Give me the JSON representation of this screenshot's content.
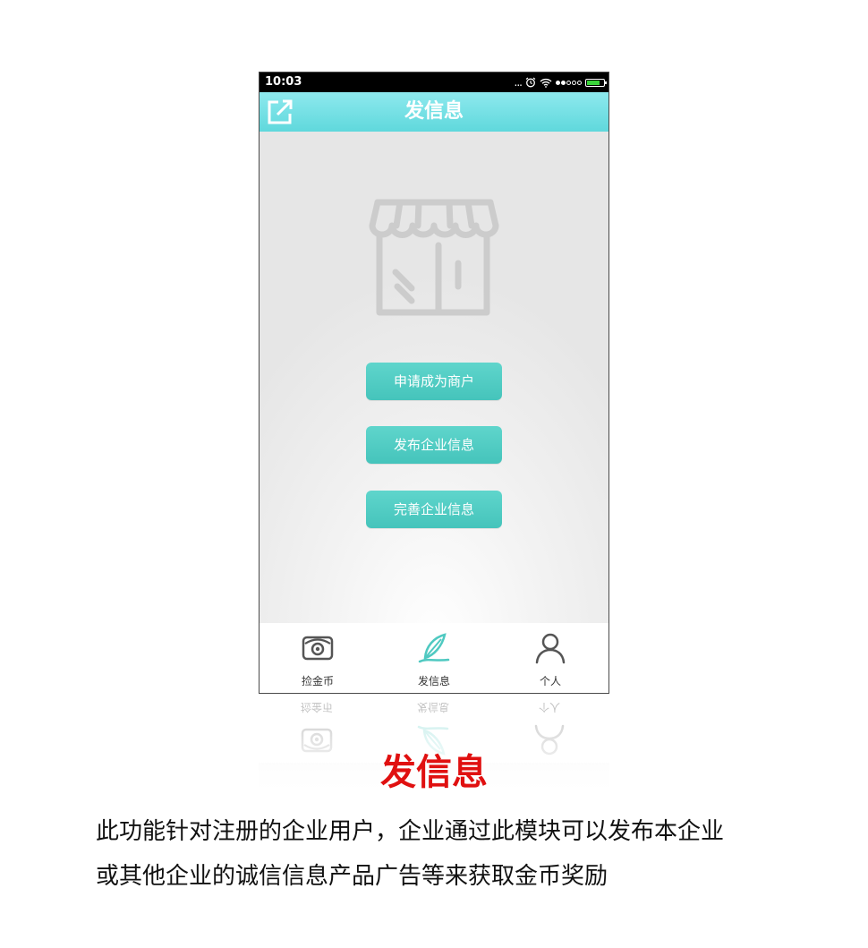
{
  "status_bar": {
    "time": "10:03",
    "dots": "...",
    "alarm_icon": "alarm-clock-icon",
    "wifi_icon": "wifi-icon",
    "battery_level": 0.75,
    "battery_color": "#3bd53b"
  },
  "nav": {
    "title": "发信息",
    "share_icon": "share-external-icon",
    "color": "#5fd8dc"
  },
  "illustration": {
    "icon": "storefront-icon",
    "color": "#cccccc"
  },
  "actions": [
    {
      "label": "申请成为商户"
    },
    {
      "label": "发布企业信息"
    },
    {
      "label": "完善企业信息"
    }
  ],
  "accent": "#4fc9c1",
  "tabbar": {
    "items": [
      {
        "label": "捡金币",
        "icon": "eye-card-icon",
        "active": false
      },
      {
        "label": "发信息",
        "icon": "feather-icon",
        "active": true
      },
      {
        "label": "个人",
        "icon": "person-icon",
        "active": false
      }
    ]
  },
  "caption": {
    "title": "发信息",
    "title_color": "#e01010",
    "lines": [
      "此功能针对注册的企业用户，企业通过此模块可以发布本企业",
      "或其他企业的诚信信息产品广告等来获取金币奖励"
    ]
  }
}
